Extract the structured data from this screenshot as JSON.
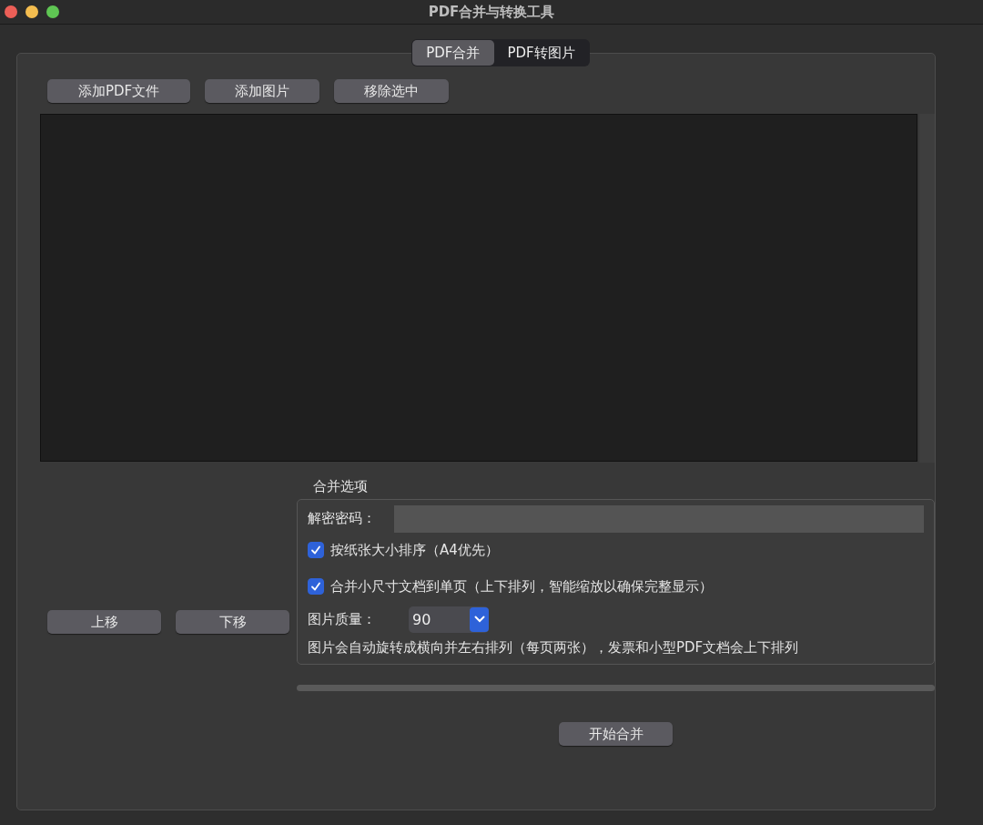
{
  "window": {
    "title": "PDF合并与转换工具"
  },
  "tabs": [
    {
      "label": "PDF合并",
      "selected": true
    },
    {
      "label": "PDF转图片",
      "selected": false
    }
  ],
  "toolbar": {
    "buttons": [
      "添加PDF文件",
      "添加图片",
      "移除选中"
    ]
  },
  "move_buttons": [
    "上移",
    "下移"
  ],
  "merge_options": {
    "title": "合并选项",
    "password": {
      "label": "解密密码："
    },
    "checkboxes": [
      {
        "label": "按纸张大小排序（A4优先）",
        "checked": true
      },
      {
        "label": "合并小尺寸文档到单页（上下排列，智能缩放以确保完整显示）",
        "checked": true
      }
    ],
    "quality": {
      "label": "图片质量：",
      "value": "90"
    },
    "note": "图片会自动旋转成横向并左右排列（每页两张），发票和小型PDF文档会上下排列"
  },
  "progress": {
    "level": 0
  },
  "start_button": "开始合并"
}
